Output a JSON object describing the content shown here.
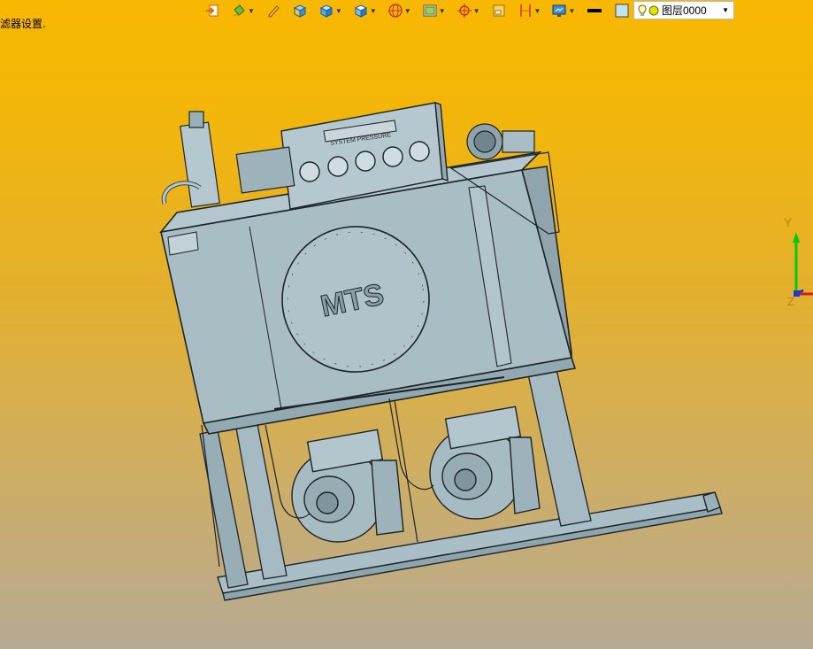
{
  "status": {
    "text": "滤器设置."
  },
  "toolbar": {
    "items": [
      {
        "name": "exit-sketch-icon",
        "has_dropdown": false
      },
      {
        "name": "paint-bucket-icon",
        "has_dropdown": true
      },
      {
        "name": "pencil-icon",
        "has_dropdown": false
      },
      {
        "name": "box-shaded-icon",
        "has_dropdown": false
      },
      {
        "name": "cube-view-icon",
        "has_dropdown": true
      },
      {
        "name": "cube-orient-icon",
        "has_dropdown": true
      },
      {
        "name": "sphere-wire-icon",
        "has_dropdown": true
      },
      {
        "name": "image-capture-icon",
        "has_dropdown": true
      },
      {
        "name": "crosshair-target-icon",
        "has_dropdown": true
      },
      {
        "name": "note-icon",
        "has_dropdown": false
      },
      {
        "name": "dimension-icon",
        "has_dropdown": true
      },
      {
        "name": "monitor-render-icon",
        "has_dropdown": true
      },
      {
        "name": "line-color-icon",
        "has_dropdown": false
      },
      {
        "name": "fill-color-icon",
        "has_dropdown": false
      },
      {
        "name": "layer-plane-icon",
        "has_dropdown": true
      }
    ],
    "line_color": "#000000",
    "fill_color": "#bfe6f2"
  },
  "layer": {
    "selected": "图层0000"
  },
  "model_text": {
    "panel_label": "SYSTEM PRESSURE",
    "logo": "MTS"
  },
  "axes": {
    "y_label": "Y",
    "z_label": "Z"
  },
  "colors": {
    "model_fill": "#a7bcc4",
    "model_line": "#1c2428",
    "axis_y": "#00cc00",
    "axis_z": "#1a3ad6"
  }
}
